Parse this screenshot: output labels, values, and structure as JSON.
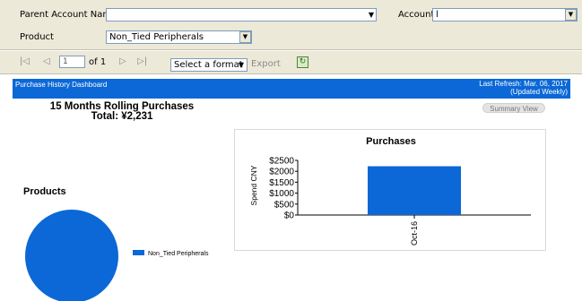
{
  "params": {
    "parent_account_label": "Parent Account Name",
    "parent_account_value": "",
    "account_label": "Account",
    "account_value": "l",
    "product_label": "Product",
    "product_value": "Non_Tied Peripherals"
  },
  "toolbar": {
    "first_glyph": "|◁",
    "prev_glyph": "◁",
    "page_value": "1",
    "of_pages": "of 1",
    "next_glyph": "▷",
    "last_glyph": "▷|",
    "format_placeholder": "Select a format",
    "export_label": "Export"
  },
  "report": {
    "banner_title": "Purchase History Dashboard",
    "last_refresh": "Last Refresh: Mar. 06, 2017",
    "update_freq": "(Updated Weekly)",
    "rolling_title": "15 Months Rolling Purchases",
    "rolling_total": "Total: ¥2,231",
    "summary_button": "Summary View",
    "products_title": "Products"
  },
  "chart_data": [
    {
      "type": "bar",
      "title": "Purchases",
      "ylabel": "Spend CNY",
      "categories": [
        "Oct-16"
      ],
      "values": [
        2231
      ],
      "ylim": [
        0,
        2500
      ],
      "yticks": [
        "$0",
        "$500",
        "$1000",
        "$1500",
        "$2000",
        "$2500"
      ],
      "color": "#0b68d6"
    },
    {
      "type": "pie",
      "labels": [
        "Non_Tied Peripherals"
      ],
      "values": [
        100
      ],
      "colors": [
        "#0b68d6"
      ],
      "legend": "right"
    }
  ]
}
